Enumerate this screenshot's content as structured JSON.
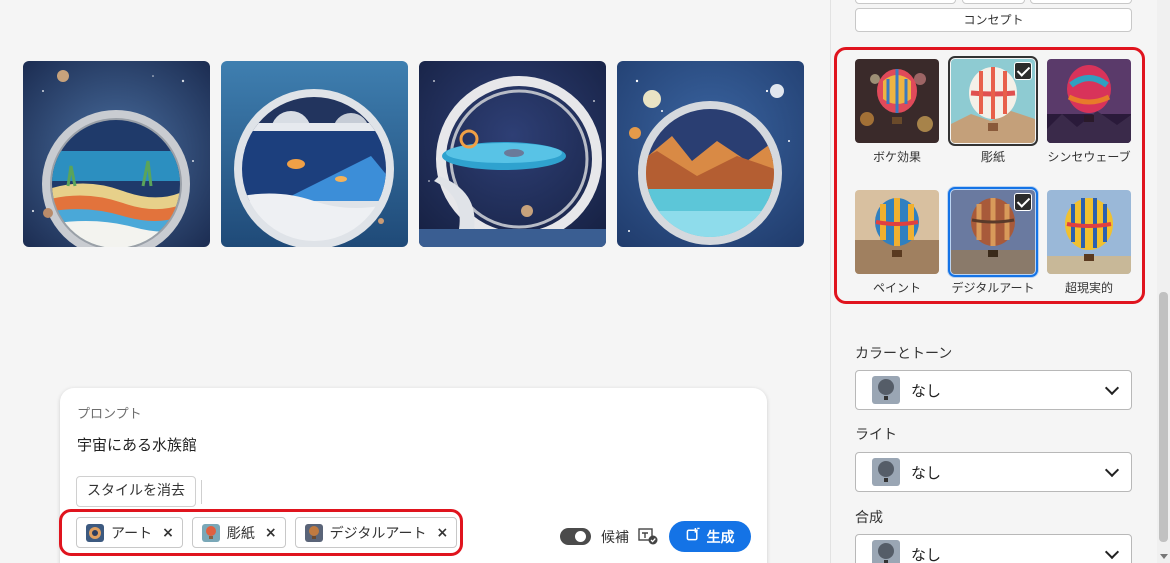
{
  "prompt": {
    "label": "プロンプト",
    "text": "宇宙にある水族館",
    "clear_style_label": "スタイルを消去",
    "chips": [
      {
        "label": "アート",
        "icon": "art-thumb-icon"
      },
      {
        "label": "彫紙",
        "icon": "paper-thumb-icon"
      },
      {
        "label": "デジタルアート",
        "icon": "digital-art-thumb-icon"
      }
    ],
    "remove_glyph": "×",
    "toggle_label": "候補",
    "generate_label": "生成"
  },
  "panel": {
    "concept_label": "コンセプト",
    "styles": [
      {
        "name": "ボケ効果",
        "selected": false
      },
      {
        "name": "彫紙",
        "selected": true
      },
      {
        "name": "シンセウェーブ",
        "selected": false
      },
      {
        "name": "ペイント",
        "selected": false
      },
      {
        "name": "デジタルアート",
        "selected": true
      },
      {
        "name": "超現実的",
        "selected": false
      }
    ],
    "color_tone": {
      "label": "カラーとトーン",
      "value": "なし"
    },
    "light": {
      "label": "ライト",
      "value": "なし"
    },
    "composition": {
      "label": "合成",
      "value": "なし"
    }
  },
  "colors": {
    "accent": "#1473e6",
    "highlight_red": "#e0141e"
  }
}
